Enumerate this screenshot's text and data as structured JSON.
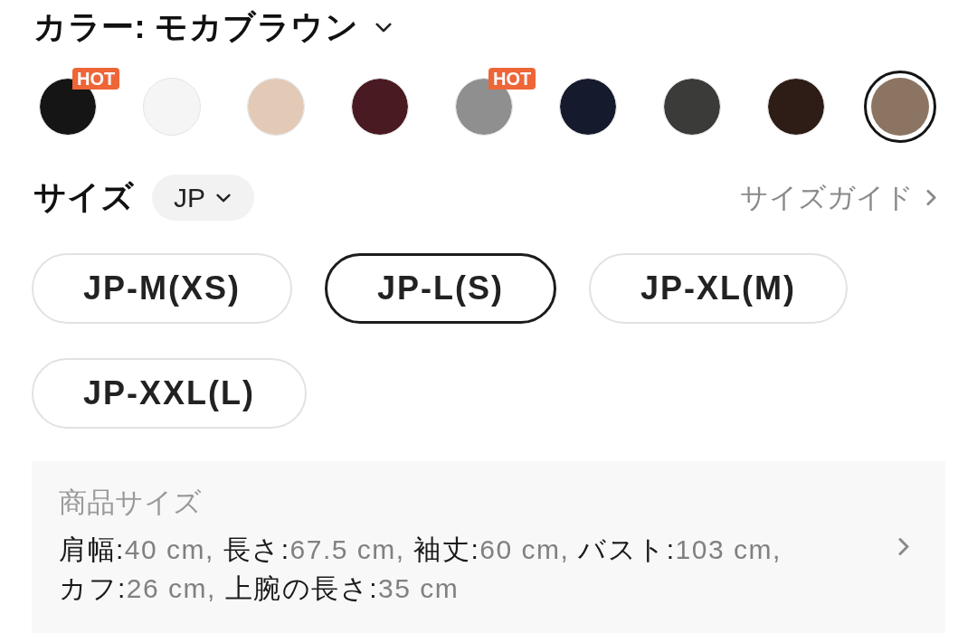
{
  "color_section": {
    "label": "カラー: モカブラウン",
    "options": [
      {
        "color": "#151515",
        "selected": false,
        "badge": "HOT"
      },
      {
        "color": "#f5f5f5",
        "selected": false
      },
      {
        "color": "#e2cab7",
        "selected": false
      },
      {
        "color": "#4a1a22",
        "selected": false
      },
      {
        "color": "#8f8f8f",
        "selected": false,
        "badge": "HOT"
      },
      {
        "color": "#151a2c",
        "selected": false
      },
      {
        "color": "#3b3c39",
        "selected": false
      },
      {
        "color": "#2e1d16",
        "selected": false
      },
      {
        "color": "#8b7461",
        "selected": true
      }
    ]
  },
  "size_section": {
    "label": "サイズ",
    "region_selector": "JP",
    "guide_link": "サイズガイド",
    "sizes": [
      {
        "label": "JP-M(XS)",
        "selected": false
      },
      {
        "label": "JP-L(S)",
        "selected": true
      },
      {
        "label": "JP-XL(M)",
        "selected": false
      },
      {
        "label": "JP-XXL(L)",
        "selected": false
      }
    ]
  },
  "product_size": {
    "title": "商品サイズ",
    "measurements": [
      {
        "label": "肩幅:",
        "value": "40 cm,"
      },
      {
        "label": "長さ:",
        "value": "67.5 cm,"
      },
      {
        "label": "袖丈:",
        "value": "60 cm,"
      },
      {
        "label": "バスト:",
        "value": "103 cm,"
      },
      {
        "label": "カフ:",
        "value": "26 cm,"
      },
      {
        "label": "上腕の長さ:",
        "value": "35 cm"
      }
    ]
  }
}
